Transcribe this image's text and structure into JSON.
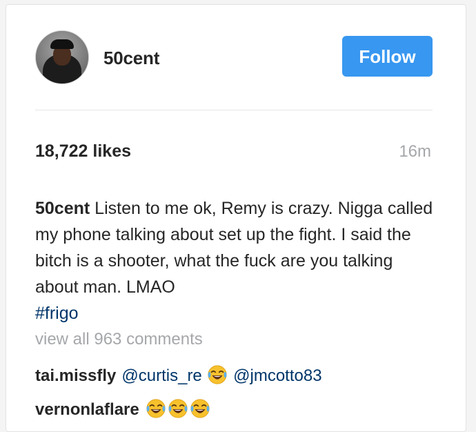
{
  "post": {
    "username": "50cent",
    "follow_label": "Follow",
    "likes": "18,722 likes",
    "time_ago": "16m",
    "caption": {
      "author": "50cent",
      "text": "Listen to me ok, Remy is crazy. Nigga called my phone talking about set up the fight. I said the bitch is a shooter, what the fuck are you talking about man. LMAO",
      "hashtag": "#frigo"
    },
    "view_all_comments": "view all 963 comments",
    "comments": [
      {
        "user": "tai.missfly",
        "mention_1": "@curtis_re",
        "emoji": "face-with-tears-of-joy",
        "mention_2": "@jmcotto83"
      },
      {
        "user": "vernonlaflare",
        "emoji": "face-with-tears-of-joy",
        "emoji_count": 3
      }
    ]
  },
  "colors": {
    "follow_button": "#3897f0",
    "link_text": "#003569",
    "muted_text": "#a5a7aa",
    "primary_text": "#262626"
  }
}
